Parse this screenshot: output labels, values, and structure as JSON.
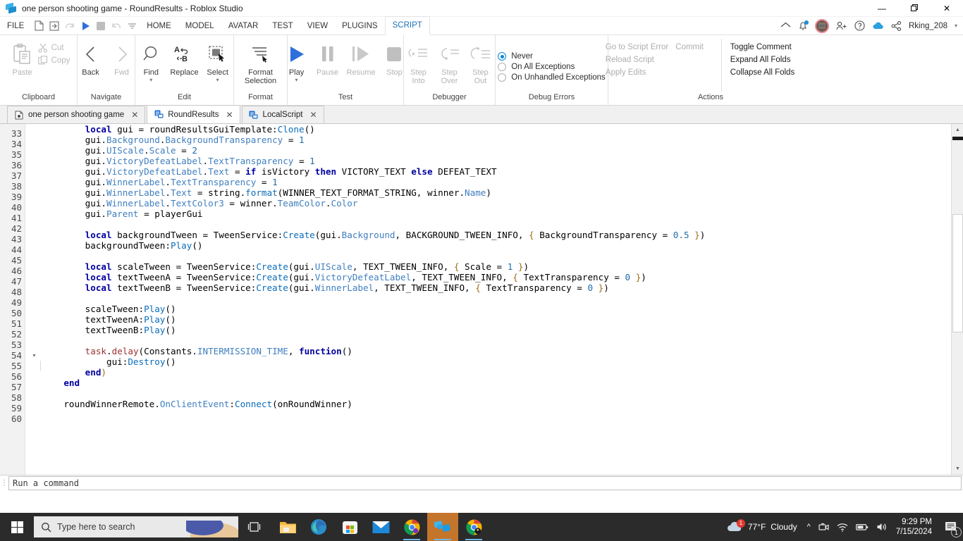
{
  "window": {
    "title": "one person  shooting game - RoundResults - Roblox Studio",
    "icon": "roblox-studio-icon",
    "minimize": "—",
    "maximize": "❐",
    "close": "✕"
  },
  "menu": {
    "file": "FILE",
    "quick": [
      "new-file-icon",
      "open-file-icon",
      "redo-icon",
      "play-icon",
      "stop-icon",
      "undo-icon",
      "customize-icon"
    ],
    "tabs": [
      {
        "label": "HOME",
        "active": false
      },
      {
        "label": "MODEL",
        "active": false
      },
      {
        "label": "AVATAR",
        "active": false
      },
      {
        "label": "TEST",
        "active": false
      },
      {
        "label": "VIEW",
        "active": false
      },
      {
        "label": "PLUGINS",
        "active": false
      },
      {
        "label": "SCRIPT",
        "active": true
      }
    ],
    "right": {
      "home_icon": "home-icon",
      "notification_icon": "bell-icon",
      "avatar_icon": "avatar-icon",
      "add_person_icon": "add-person-icon",
      "help_icon": "help-icon",
      "cloud_icon": "cloud-icon",
      "share_icon": "share-icon",
      "username": "Rking_208",
      "caret": "▾"
    }
  },
  "ribbon": {
    "groups": [
      {
        "name": "Clipboard",
        "label": "Clipboard",
        "items": [
          {
            "label": "Paste",
            "icon": "paste-icon",
            "dim": true
          },
          {
            "label": "Cut",
            "icon": "scissors-icon",
            "dim": true
          },
          {
            "label": "Copy",
            "icon": "copy-icon",
            "dim": true
          }
        ]
      },
      {
        "name": "Navigate",
        "label": "Navigate",
        "items": [
          {
            "label": "Back",
            "icon": "chevron-left-icon",
            "dim": false
          },
          {
            "label": "Fwd",
            "icon": "chevron-right-icon",
            "dim": true
          }
        ]
      },
      {
        "name": "Edit",
        "label": "Edit",
        "items": [
          {
            "label": "Find",
            "icon": "magnifier-icon",
            "dim": false,
            "caret": "▾"
          },
          {
            "label": "Replace",
            "icon": "replace-ab-icon",
            "dim": false
          },
          {
            "label": "Select",
            "icon": "select-object-icon",
            "dim": false,
            "caret": "▾"
          }
        ]
      },
      {
        "name": "Format",
        "label": "Format",
        "items": [
          {
            "label": "Format\nSelection",
            "icon": "format-lines-icon",
            "dim": false,
            "caret": "▾"
          }
        ]
      },
      {
        "name": "Test",
        "label": "Test",
        "items": [
          {
            "label": "Play",
            "icon": "play-triangle-icon",
            "dim": false,
            "caret": "▾"
          },
          {
            "label": "Pause",
            "icon": "pause-icon",
            "dim": true
          },
          {
            "label": "Resume",
            "icon": "resume-icon",
            "dim": true
          },
          {
            "label": "Stop",
            "icon": "stop-square-icon",
            "dim": true
          }
        ]
      },
      {
        "name": "Debugger",
        "label": "Debugger",
        "items": [
          {
            "label": "Step\nInto",
            "icon": "step-into-icon",
            "dim": true
          },
          {
            "label": "Step\nOver",
            "icon": "step-over-icon",
            "dim": true
          },
          {
            "label": "Step\nOut",
            "icon": "step-out-icon",
            "dim": true
          }
        ]
      }
    ],
    "debug_errors": {
      "label": "Debug Errors",
      "options": [
        {
          "label": "Never",
          "selected": true
        },
        {
          "label": "On All Exceptions",
          "selected": false
        },
        {
          "label": "On Unhandled Exceptions",
          "selected": false
        }
      ]
    },
    "actions": {
      "label": "Actions",
      "left_column": [
        {
          "label": "Go to Script Error",
          "enabled": false
        },
        {
          "label": "Reload Script",
          "enabled": false
        },
        {
          "label": "Apply Edits",
          "enabled": false
        }
      ],
      "mid_column": [
        {
          "label": "Commit",
          "enabled": false
        }
      ],
      "right_column": [
        {
          "label": "Toggle Comment",
          "enabled": true
        },
        {
          "label": "Expand All Folds",
          "enabled": true
        },
        {
          "label": "Collapse All Folds",
          "enabled": true
        }
      ]
    }
  },
  "doc_tabs": [
    {
      "label": "one person  shooting game",
      "icon": "place-icon",
      "active": false,
      "close": "✕"
    },
    {
      "label": "RoundResults",
      "icon": "script-icon",
      "active": true,
      "close": "✕"
    },
    {
      "label": "LocalScript",
      "icon": "script-icon",
      "active": false,
      "close": "✕"
    }
  ],
  "editor": {
    "first_line": 33,
    "last_line": 60,
    "fold_line": 54,
    "fold_marker": "▾",
    "lines": [
      {
        "n": 33,
        "tokens": [
          {
            "t": "        ",
            "c": ""
          },
          {
            "t": "local",
            "c": "k"
          },
          {
            "t": " gui = roundResultsGuiTemplate:",
            "c": ""
          },
          {
            "t": "Clone",
            "c": "fn"
          },
          {
            "t": "()",
            "c": ""
          }
        ]
      },
      {
        "n": 34,
        "tokens": [
          {
            "t": "        gui.",
            "c": ""
          },
          {
            "t": "Background",
            "c": "pr"
          },
          {
            "t": ".",
            "c": ""
          },
          {
            "t": "BackgroundTransparency",
            "c": "pr"
          },
          {
            "t": " = ",
            "c": ""
          },
          {
            "t": "1",
            "c": "num"
          }
        ]
      },
      {
        "n": 35,
        "tokens": [
          {
            "t": "        gui.",
            "c": ""
          },
          {
            "t": "UIScale",
            "c": "pr"
          },
          {
            "t": ".",
            "c": ""
          },
          {
            "t": "Scale",
            "c": "pr"
          },
          {
            "t": " = ",
            "c": ""
          },
          {
            "t": "2",
            "c": "num"
          }
        ]
      },
      {
        "n": 36,
        "tokens": [
          {
            "t": "        gui.",
            "c": ""
          },
          {
            "t": "VictoryDefeatLabel",
            "c": "pr"
          },
          {
            "t": ".",
            "c": ""
          },
          {
            "t": "TextTransparency",
            "c": "pr"
          },
          {
            "t": " = ",
            "c": ""
          },
          {
            "t": "1",
            "c": "num"
          }
        ]
      },
      {
        "n": 37,
        "tokens": [
          {
            "t": "        gui.",
            "c": ""
          },
          {
            "t": "VictoryDefeatLabel",
            "c": "pr"
          },
          {
            "t": ".",
            "c": ""
          },
          {
            "t": "Text",
            "c": "pr"
          },
          {
            "t": " = ",
            "c": ""
          },
          {
            "t": "if",
            "c": "k"
          },
          {
            "t": " isVictory ",
            "c": ""
          },
          {
            "t": "then",
            "c": "k"
          },
          {
            "t": " VICTORY_TEXT ",
            "c": ""
          },
          {
            "t": "else",
            "c": "k"
          },
          {
            "t": " DEFEAT_TEXT",
            "c": ""
          }
        ]
      },
      {
        "n": 38,
        "tokens": [
          {
            "t": "        gui.",
            "c": ""
          },
          {
            "t": "WinnerLabel",
            "c": "pr"
          },
          {
            "t": ".",
            "c": ""
          },
          {
            "t": "TextTransparency",
            "c": "pr"
          },
          {
            "t": " = ",
            "c": ""
          },
          {
            "t": "1",
            "c": "num"
          }
        ]
      },
      {
        "n": 39,
        "tokens": [
          {
            "t": "        gui.",
            "c": ""
          },
          {
            "t": "WinnerLabel",
            "c": "pr"
          },
          {
            "t": ".",
            "c": ""
          },
          {
            "t": "Text",
            "c": "pr"
          },
          {
            "t": " = string.",
            "c": ""
          },
          {
            "t": "format",
            "c": "fn"
          },
          {
            "t": "(WINNER_TEXT_FORMAT_STRING, winner.",
            "c": ""
          },
          {
            "t": "Name",
            "c": "pr"
          },
          {
            "t": ")",
            "c": ""
          }
        ]
      },
      {
        "n": 40,
        "tokens": [
          {
            "t": "        gui.",
            "c": ""
          },
          {
            "t": "WinnerLabel",
            "c": "pr"
          },
          {
            "t": ".",
            "c": ""
          },
          {
            "t": "TextColor3",
            "c": "pr"
          },
          {
            "t": " = winner.",
            "c": ""
          },
          {
            "t": "TeamColor",
            "c": "pr"
          },
          {
            "t": ".",
            "c": ""
          },
          {
            "t": "Color",
            "c": "pr"
          }
        ]
      },
      {
        "n": 41,
        "tokens": [
          {
            "t": "        gui.",
            "c": ""
          },
          {
            "t": "Parent",
            "c": "pr"
          },
          {
            "t": " = playerGui",
            "c": ""
          }
        ]
      },
      {
        "n": 42,
        "tokens": []
      },
      {
        "n": 43,
        "tokens": [
          {
            "t": "        ",
            "c": ""
          },
          {
            "t": "local",
            "c": "k"
          },
          {
            "t": " backgroundTween = TweenService:",
            "c": ""
          },
          {
            "t": "Create",
            "c": "fn"
          },
          {
            "t": "(gui.",
            "c": ""
          },
          {
            "t": "Background",
            "c": "pr"
          },
          {
            "t": ", BACKGROUND_TWEEN_INFO, ",
            "c": ""
          },
          {
            "t": "{",
            "c": "bk"
          },
          {
            "t": " BackgroundTransparency = ",
            "c": ""
          },
          {
            "t": "0.5",
            "c": "num"
          },
          {
            "t": " }",
            "c": "bk"
          },
          {
            "t": ")",
            "c": ""
          }
        ]
      },
      {
        "n": 44,
        "tokens": [
          {
            "t": "        backgroundTween:",
            "c": ""
          },
          {
            "t": "Play",
            "c": "fn"
          },
          {
            "t": "()",
            "c": ""
          }
        ]
      },
      {
        "n": 45,
        "tokens": []
      },
      {
        "n": 46,
        "tokens": [
          {
            "t": "        ",
            "c": ""
          },
          {
            "t": "local",
            "c": "k"
          },
          {
            "t": " scaleTween = TweenService:",
            "c": ""
          },
          {
            "t": "Create",
            "c": "fn"
          },
          {
            "t": "(gui.",
            "c": ""
          },
          {
            "t": "UIScale",
            "c": "pr"
          },
          {
            "t": ", TEXT_TWEEN_INFO, ",
            "c": ""
          },
          {
            "t": "{",
            "c": "bk"
          },
          {
            "t": " Scale = ",
            "c": ""
          },
          {
            "t": "1",
            "c": "num"
          },
          {
            "t": " }",
            "c": "bk"
          },
          {
            "t": ")",
            "c": ""
          }
        ]
      },
      {
        "n": 47,
        "tokens": [
          {
            "t": "        ",
            "c": ""
          },
          {
            "t": "local",
            "c": "k"
          },
          {
            "t": " textTweenA = TweenService:",
            "c": ""
          },
          {
            "t": "Create",
            "c": "fn"
          },
          {
            "t": "(gui.",
            "c": ""
          },
          {
            "t": "VictoryDefeatLabel",
            "c": "pr"
          },
          {
            "t": ", TEXT_TWEEN_INFO, ",
            "c": ""
          },
          {
            "t": "{",
            "c": "bk"
          },
          {
            "t": " TextTransparency = ",
            "c": ""
          },
          {
            "t": "0",
            "c": "num"
          },
          {
            "t": " }",
            "c": "bk"
          },
          {
            "t": ")",
            "c": ""
          }
        ]
      },
      {
        "n": 48,
        "tokens": [
          {
            "t": "        ",
            "c": ""
          },
          {
            "t": "local",
            "c": "k"
          },
          {
            "t": " textTweenB = TweenService:",
            "c": ""
          },
          {
            "t": "Create",
            "c": "fn"
          },
          {
            "t": "(gui.",
            "c": ""
          },
          {
            "t": "WinnerLabel",
            "c": "pr"
          },
          {
            "t": ", TEXT_TWEEN_INFO, ",
            "c": ""
          },
          {
            "t": "{",
            "c": "bk"
          },
          {
            "t": " TextTransparency = ",
            "c": ""
          },
          {
            "t": "0",
            "c": "num"
          },
          {
            "t": " }",
            "c": "bk"
          },
          {
            "t": ")",
            "c": ""
          }
        ]
      },
      {
        "n": 49,
        "tokens": []
      },
      {
        "n": 50,
        "tokens": [
          {
            "t": "        scaleTween:",
            "c": ""
          },
          {
            "t": "Play",
            "c": "fn"
          },
          {
            "t": "()",
            "c": ""
          }
        ]
      },
      {
        "n": 51,
        "tokens": [
          {
            "t": "        textTweenA:",
            "c": ""
          },
          {
            "t": "Play",
            "c": "fn"
          },
          {
            "t": "()",
            "c": ""
          }
        ]
      },
      {
        "n": 52,
        "tokens": [
          {
            "t": "        textTweenB:",
            "c": ""
          },
          {
            "t": "Play",
            "c": "fn"
          },
          {
            "t": "()",
            "c": ""
          }
        ]
      },
      {
        "n": 53,
        "tokens": []
      },
      {
        "n": 54,
        "tokens": [
          {
            "t": "        ",
            "c": ""
          },
          {
            "t": "task",
            "c": "nm"
          },
          {
            "t": ".",
            "c": ""
          },
          {
            "t": "delay",
            "c": "nm"
          },
          {
            "t": "(Constants.",
            "c": ""
          },
          {
            "t": "INTERMISSION_TIME",
            "c": "pr"
          },
          {
            "t": ", ",
            "c": ""
          },
          {
            "t": "function",
            "c": "k"
          },
          {
            "t": "()",
            "c": ""
          }
        ]
      },
      {
        "n": 55,
        "tokens": [
          {
            "t": "            gui:",
            "c": ""
          },
          {
            "t": "Destroy",
            "c": "fn"
          },
          {
            "t": "()",
            "c": ""
          }
        ]
      },
      {
        "n": 56,
        "tokens": [
          {
            "t": "        ",
            "c": ""
          },
          {
            "t": "end",
            "c": "k"
          },
          {
            "t": ")",
            "c": "bk"
          }
        ]
      },
      {
        "n": 57,
        "tokens": [
          {
            "t": "    ",
            "c": ""
          },
          {
            "t": "end",
            "c": "k"
          }
        ]
      },
      {
        "n": 58,
        "tokens": []
      },
      {
        "n": 59,
        "tokens": [
          {
            "t": "    roundWinnerRemote.",
            "c": ""
          },
          {
            "t": "OnClientEvent",
            "c": "pr"
          },
          {
            "t": ":",
            "c": ""
          },
          {
            "t": "Connect",
            "c": "fn"
          },
          {
            "t": "(onRoundWinner)",
            "c": ""
          }
        ]
      },
      {
        "n": 60,
        "tokens": []
      }
    ],
    "scroll_up_arrow": "▲",
    "scroll_down_arrow": "▼"
  },
  "command_bar": {
    "grip": "⋮",
    "placeholder": "Run a command",
    "value": "Run a command"
  },
  "taskbar": {
    "start_icon": "windows-start-icon",
    "search_placeholder": "Type here to search",
    "search_icon": "search-icon",
    "task_view_icon": "task-view-icon",
    "apps": [
      {
        "name": "file-explorer-icon",
        "running": false,
        "active": false
      },
      {
        "name": "microsoft-edge-icon",
        "running": false,
        "active": false
      },
      {
        "name": "microsoft-store-icon",
        "running": false,
        "active": false
      },
      {
        "name": "mail-icon",
        "running": false,
        "active": false
      },
      {
        "name": "chrome-icon",
        "running": true,
        "active": false
      },
      {
        "name": "roblox-studio-icon",
        "running": true,
        "active": true
      },
      {
        "name": "chrome-profile-icon",
        "running": true,
        "active": false
      }
    ],
    "weather": {
      "icon": "cloud-weather-icon",
      "badge": "1",
      "temperature": "77°F",
      "condition": "Cloudy"
    },
    "tray": {
      "chevron": "∧",
      "icons": [
        "camera-icon",
        "wifi-icon",
        "battery-icon",
        "volume-icon"
      ]
    },
    "clock": {
      "time": "9:29 PM",
      "date": "7/15/2024"
    },
    "notifications": {
      "icon": "notification-icon",
      "count": "1"
    }
  },
  "colors": {
    "accent_blue": "#1b72b8",
    "keyword_blue": "#00009f",
    "function_blue": "#0a6cba",
    "property_blue": "#3f7fbf",
    "number_blue": "#1e6ca8",
    "global_red": "#9a3232",
    "taskbar_bg": "#2b2b2b",
    "active_task_bg": "#c4752c"
  }
}
